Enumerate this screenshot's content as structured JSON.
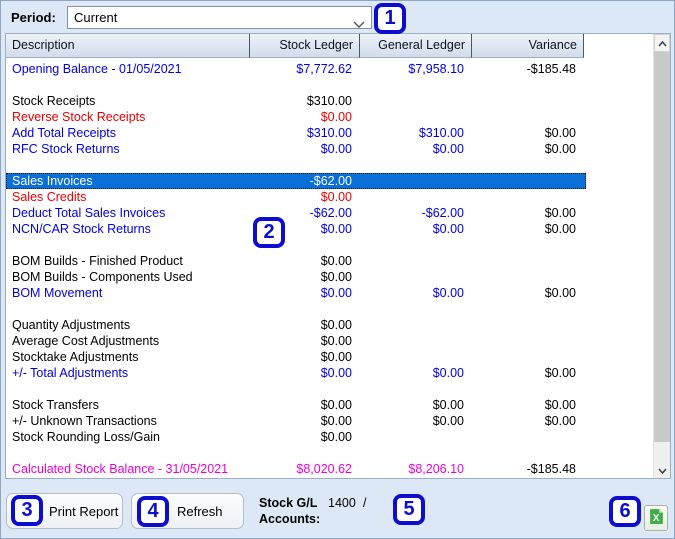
{
  "period": {
    "label": "Period:",
    "value": "Current"
  },
  "table": {
    "headers": {
      "description": "Description",
      "stock_ledger": "Stock Ledger",
      "general_ledger": "General Ledger",
      "variance": "Variance"
    },
    "rows": [
      {
        "color": "blue",
        "desc": "Opening Balance - 01/05/2021",
        "stock": "$7,772.62",
        "general": "$7,958.10",
        "variance": "-$185.48"
      },
      {
        "blank": true
      },
      {
        "color": "black",
        "desc": "Stock Receipts",
        "stock": "$310.00"
      },
      {
        "color": "red",
        "desc": "Reverse Stock Receipts",
        "stock": "$0.00"
      },
      {
        "color": "blue",
        "desc": "Add Total Receipts",
        "stock": "$310.00",
        "general": "$310.00",
        "variance": "$0.00"
      },
      {
        "color": "blue",
        "desc": "RFC Stock Returns",
        "stock": "$0.00",
        "general": "$0.00",
        "variance": "$0.00"
      },
      {
        "blank": true
      },
      {
        "color": "selected",
        "desc": "Sales Invoices",
        "stock": "-$62.00"
      },
      {
        "color": "red",
        "desc": "Sales Credits",
        "stock": "$0.00"
      },
      {
        "color": "blue",
        "desc": "Deduct Total Sales Invoices",
        "stock": "-$62.00",
        "general": "-$62.00",
        "variance": "$0.00"
      },
      {
        "color": "blue",
        "desc": "NCN/CAR Stock Returns",
        "stock": "$0.00",
        "general": "$0.00",
        "variance": "$0.00"
      },
      {
        "blank": true
      },
      {
        "color": "black",
        "desc": "BOM Builds - Finished Product",
        "stock": "$0.00"
      },
      {
        "color": "black",
        "desc": "BOM Builds - Components Used",
        "stock": "$0.00"
      },
      {
        "color": "blue",
        "desc": "BOM Movement",
        "stock": "$0.00",
        "general": "$0.00",
        "variance": "$0.00"
      },
      {
        "blank": true
      },
      {
        "color": "black",
        "desc": "Quantity Adjustments",
        "stock": "$0.00"
      },
      {
        "color": "black",
        "desc": "Average Cost Adjustments",
        "stock": "$0.00"
      },
      {
        "color": "black",
        "desc": "Stocktake Adjustments",
        "stock": "$0.00"
      },
      {
        "color": "blue",
        "desc": "+/- Total Adjustments",
        "stock": "$0.00",
        "general": "$0.00",
        "variance": "$0.00"
      },
      {
        "blank": true
      },
      {
        "color": "black",
        "desc": "Stock Transfers",
        "stock": "$0.00",
        "general": "$0.00",
        "variance": "$0.00"
      },
      {
        "color": "black",
        "desc": "+/- Unknown Transactions",
        "stock": "$0.00",
        "general": "$0.00",
        "variance": "$0.00"
      },
      {
        "color": "black",
        "desc": "Stock Rounding Loss/Gain",
        "stock": "$0.00"
      },
      {
        "blank": true
      },
      {
        "color": "magenta",
        "desc": "Calculated Stock Balance - 31/05/2021",
        "stock": "$8,020.62",
        "general": "$8,206.10",
        "variance": "-$185.48"
      }
    ]
  },
  "footer": {
    "print_label": "Print Report",
    "refresh_label": "Refresh",
    "stock_gl_line1": "Stock G/L",
    "stock_gl_line2": "Accounts:",
    "stock_gl_value": "1400",
    "stock_gl_separator": "/"
  },
  "annotations": [
    "1",
    "2",
    "3",
    "4",
    "5",
    "6"
  ],
  "colors": {
    "row_blue": "#0000e6",
    "row_red": "#ee0000",
    "row_magenta": "#ee00d4",
    "selected_row_bg": "#0b6fd8",
    "badge_blue": "#0d0dd0",
    "window_bg": "#dce8f5",
    "excel_green": "#3fae49"
  }
}
